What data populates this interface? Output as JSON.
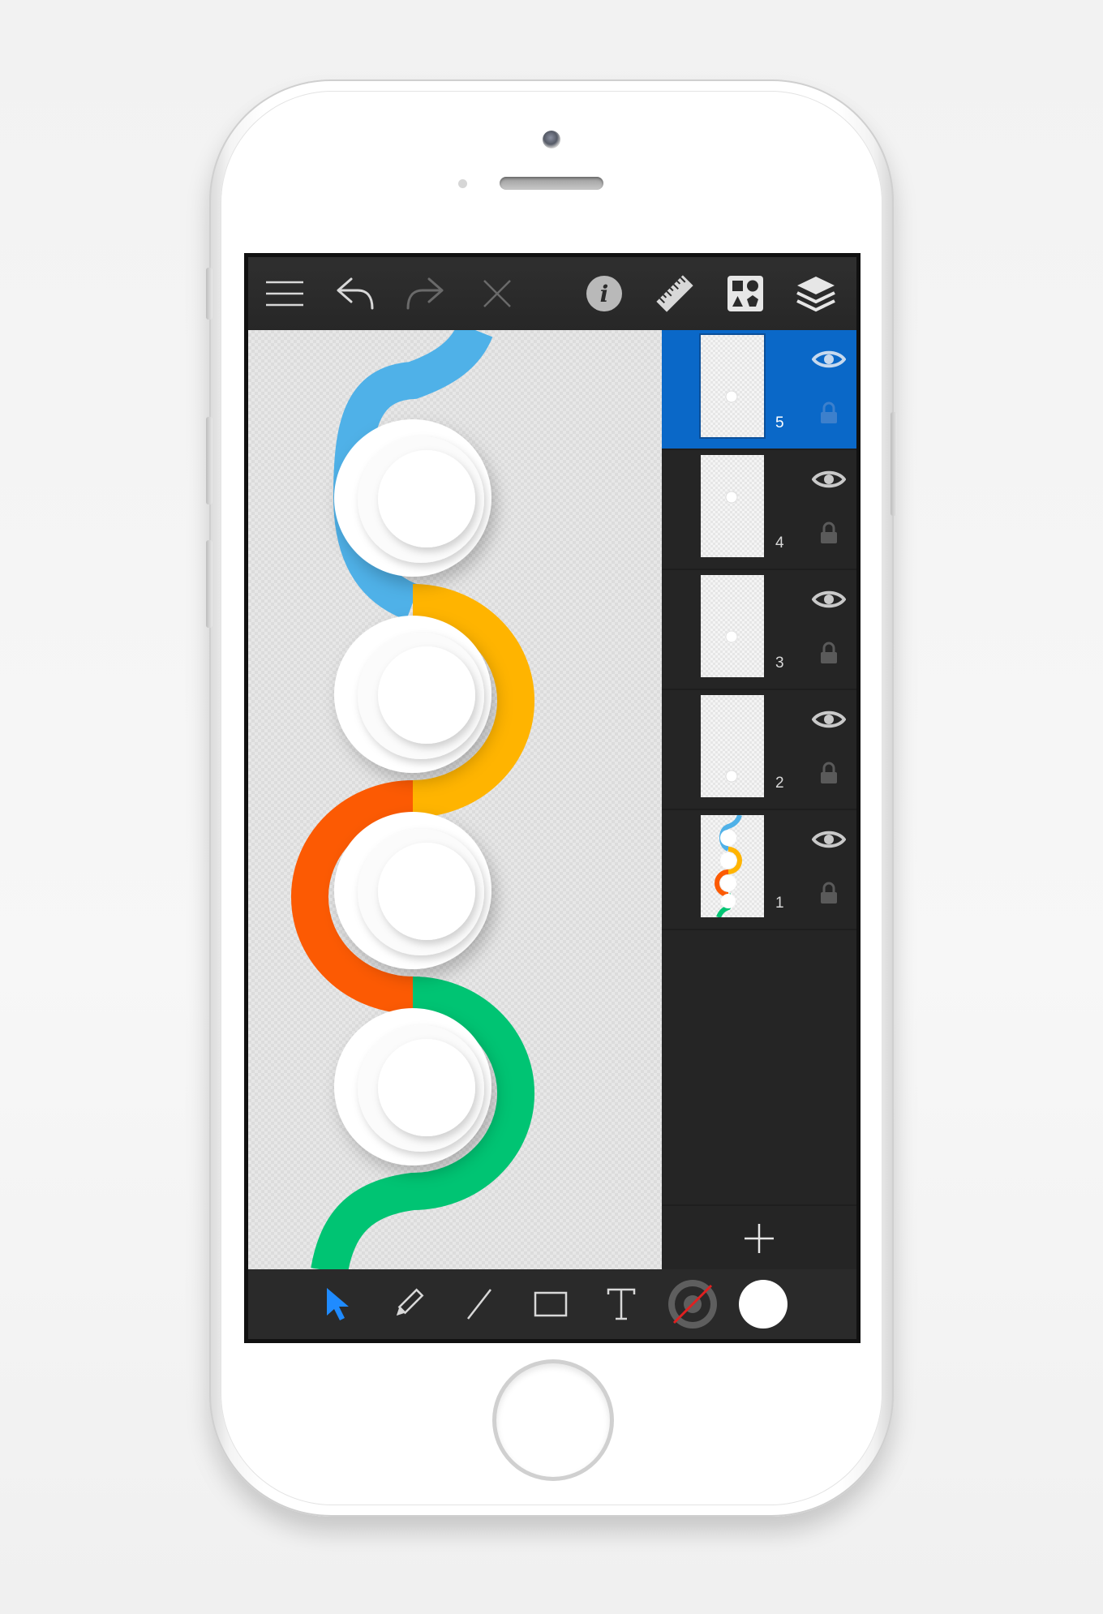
{
  "toolbar": {
    "menu_icon": "hamburger-menu-icon",
    "undo_icon": "undo-arrow-icon",
    "redo_icon": "redo-arrow-icon",
    "close_icon": "close-x-icon",
    "info_icon": "info-icon",
    "ruler_icon": "ruler-icon",
    "shapes_icon": "shapes-library-icon",
    "layers_icon": "layers-stack-icon"
  },
  "canvas": {
    "segment_colors": [
      "#4fb1e8",
      "#ffb400",
      "#fc5a03",
      "#00c473"
    ],
    "circle_color": "#ffffff"
  },
  "layers": [
    {
      "number": "5",
      "selected": true
    },
    {
      "number": "4",
      "selected": false
    },
    {
      "number": "3",
      "selected": false
    },
    {
      "number": "2",
      "selected": false
    },
    {
      "number": "1",
      "selected": false
    }
  ],
  "colors": {
    "selection_blue": "#0a68c8",
    "panel_dark": "#252525",
    "active_tool_blue": "#1f8bff",
    "stroke_indicator_red": "#e02020",
    "fill_color": "#ffffff"
  },
  "bottom_tools": {
    "select": "select-arrow-icon",
    "pencil": "pencil-icon",
    "line": "line-icon",
    "rectangle": "rectangle-icon",
    "text": "text-T-icon",
    "stroke": "stroke-color-icon",
    "fill": "fill-color-icon"
  }
}
